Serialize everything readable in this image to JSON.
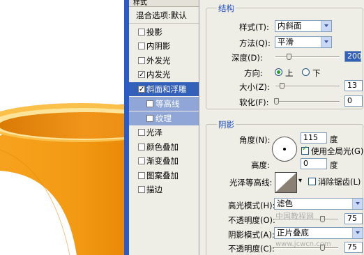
{
  "style_list": {
    "header": "样式",
    "blend_options": "混合选项:默认",
    "items": [
      {
        "label": "投影",
        "checked": false
      },
      {
        "label": "内阴影",
        "checked": false
      },
      {
        "label": "外发光",
        "checked": false
      },
      {
        "label": "内发光",
        "checked": true
      },
      {
        "label": "斜面和浮雕",
        "checked": true,
        "selected": true
      },
      {
        "label": "等高线",
        "checked": false,
        "sub": true
      },
      {
        "label": "纹理",
        "checked": false,
        "sub": true
      },
      {
        "label": "光泽",
        "checked": false
      },
      {
        "label": "颜色叠加",
        "checked": false
      },
      {
        "label": "渐变叠加",
        "checked": false
      },
      {
        "label": "图案叠加",
        "checked": false
      },
      {
        "label": "描边",
        "checked": false
      }
    ]
  },
  "structure": {
    "title": "结构",
    "style_label": "样式(T):",
    "style_value": "内斜面",
    "technique_label": "方法(Q):",
    "technique_value": "平滑",
    "depth_label": "深度(D):",
    "depth_value": "200",
    "direction_label": "方向:",
    "direction_up": "上",
    "direction_down": "下",
    "size_label": "大小(Z):",
    "size_value": "13",
    "soften_label": "软化(F):",
    "soften_value": "0"
  },
  "shading": {
    "title": "阴影",
    "angle_label": "角度(N):",
    "angle_value": "115",
    "degree_unit": "度",
    "global_light_label": "使用全局光(G)",
    "altitude_label": "高度:",
    "altitude_value": "0",
    "gloss_contour_label": "光泽等高线:",
    "antialiased_label": "消除锯齿(L)",
    "highlight_mode_label": "高光模式(H):",
    "highlight_mode_value": "滤色",
    "highlight_opacity_label": "不透明度(O):",
    "highlight_opacity_value": "75",
    "shadow_mode_label": "阴影模式(A):",
    "shadow_mode_value": "正片叠底",
    "shadow_opacity_label": "不透明度(C):",
    "shadow_opacity_value": "75"
  },
  "watermark": {
    "line1": "中国教程网",
    "line2": "www.jcwcn.com"
  },
  "colors": {
    "orange": "#f59a1a",
    "selection": "#3360b8",
    "accent_blue": "#2a5bc8"
  }
}
